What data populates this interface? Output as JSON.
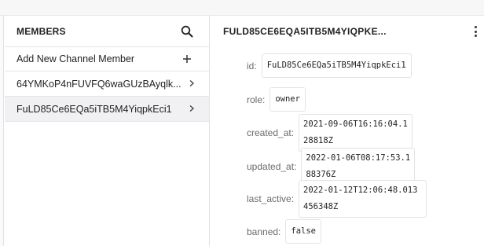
{
  "members_panel": {
    "title": "MEMBERS",
    "search_icon": "search-icon",
    "add_member_label": "Add New Channel Member",
    "add_icon": "plus-icon",
    "items": [
      {
        "label": "64YMKoP4nFUVFQ6waGUzBAyqlk..."
      },
      {
        "label": "FuLD85Ce6EQa5iTB5M4YiqpkEci1"
      }
    ],
    "selected_index": 1
  },
  "detail_panel": {
    "title": "FULD85CE6EQA5ITB5M4YIQPKE...",
    "menu_icon": "kebab-menu-icon",
    "fields": {
      "id": {
        "label": "id:",
        "value": "FuLD85Ce6EQa5iTB5M4YiqpkEci1"
      },
      "role": {
        "label": "role:",
        "value": "owner"
      },
      "created_at": {
        "label": "created_at:",
        "value": "2021-09-06T16:16:04.128818Z"
      },
      "updated_at": {
        "label": "updated_at:",
        "value": "2022-01-06T08:17:53.188376Z"
      },
      "last_active": {
        "label": "last_active:",
        "value": "2022-01-12T12:06:48.013456348Z"
      },
      "banned": {
        "label": "banned:",
        "value": "false"
      }
    }
  }
}
